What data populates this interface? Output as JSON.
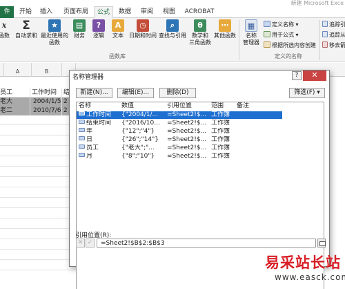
{
  "app_title": "新建 Microsoft Exce",
  "tabs": [
    "件",
    "开始",
    "插入",
    "页面布局",
    "公式",
    "数据",
    "审阅",
    "视图",
    "ACROBAT"
  ],
  "active_tab": "公式",
  "colors": {
    "excel_green": "#217346",
    "selection_blue": "#1f6fd1",
    "watermark_red": "#d81e25",
    "close_red": "#c94343"
  },
  "ribbon": {
    "func_lib": {
      "insert_function": {
        "label": "函数",
        "icon": "fx-icon"
      },
      "autosum": {
        "label1": "自动求和",
        "icon": "sigma-icon"
      },
      "recent": {
        "label1": "最近使用的",
        "label2": "函数",
        "icon": "star-icon"
      },
      "financial": {
        "label1": "财务",
        "icon": "book-icon"
      },
      "logical": {
        "label1": "逻辑",
        "icon": "question-icon"
      },
      "text": {
        "label1": "文本",
        "icon": "text-icon"
      },
      "datetime": {
        "label1": "日期和时间",
        "icon": "clock-icon"
      },
      "lookup": {
        "label1": "查找与引用",
        "icon": "lookup-icon"
      },
      "math": {
        "label1": "数学和",
        "label2": "三角函数",
        "icon": "theta-icon"
      },
      "more": {
        "label1": "其他函数",
        "icon": "more-icon"
      },
      "group_label": "函数库"
    },
    "defined_names": {
      "name_manager": {
        "label1": "名称",
        "label2": "管理器"
      },
      "define_name": "定义名称",
      "use_in_formula": "用于公式",
      "create_from_selection": "根据所选内容创建",
      "group_label": "定义的名称"
    },
    "auditing": {
      "trace_precedents": "追踪引",
      "trace_dependents": "追踪从",
      "remove_arrows": "移去箭"
    }
  },
  "sheet": {
    "columns": [
      "A",
      "B"
    ],
    "rows": [
      {
        "a": "员工",
        "b": "工作时间",
        "c": "结"
      },
      {
        "a": "老大",
        "b": "2004/1/5",
        "c": "2"
      },
      {
        "a": "老二",
        "b": "2010/7/6",
        "c": "2"
      }
    ]
  },
  "dialog": {
    "title": "名称管理器",
    "help": "?",
    "close": "✕",
    "buttons": {
      "new": "新建(N)...",
      "edit": "编辑(E)...",
      "delete": "删除(D)",
      "filter": "筛选(F) ▾"
    },
    "headers": {
      "name": "名称",
      "value": "数值",
      "refers": "引用位置",
      "scope": "范围",
      "comment": "备注"
    },
    "items": [
      {
        "name": "工作时间",
        "value": "{\"2004/1/...",
        "refers": "=Sheet2!$...",
        "scope": "工作簿"
      },
      {
        "name": "结束时间",
        "value": "{\"2016/10...",
        "refers": "=Sheet2!$...",
        "scope": "工作簿"
      },
      {
        "name": "年",
        "value": "{\"12\";\"4\"}",
        "refers": "=Sheet2!$...",
        "scope": "工作簿"
      },
      {
        "name": "日",
        "value": "{\"26\";\"14\"}",
        "refers": "=Sheet2!$...",
        "scope": "工作簿"
      },
      {
        "name": "员工",
        "value": "{\"老大\";\"...",
        "refers": "=Sheet2!$...",
        "scope": "工作簿"
      },
      {
        "name": "月",
        "value": "{\"8\";\"10\"}",
        "refers": "=Sheet2!$...",
        "scope": "工作簿"
      }
    ],
    "selected_index": 0,
    "ref_label": "引用位置(R):",
    "ref_value": "=Sheet2!$B$2:$B$3",
    "ref_cancel": "✕",
    "ref_ok": "✓"
  },
  "watermark": {
    "text": "易采站长站",
    "url": "www.easck.com"
  }
}
